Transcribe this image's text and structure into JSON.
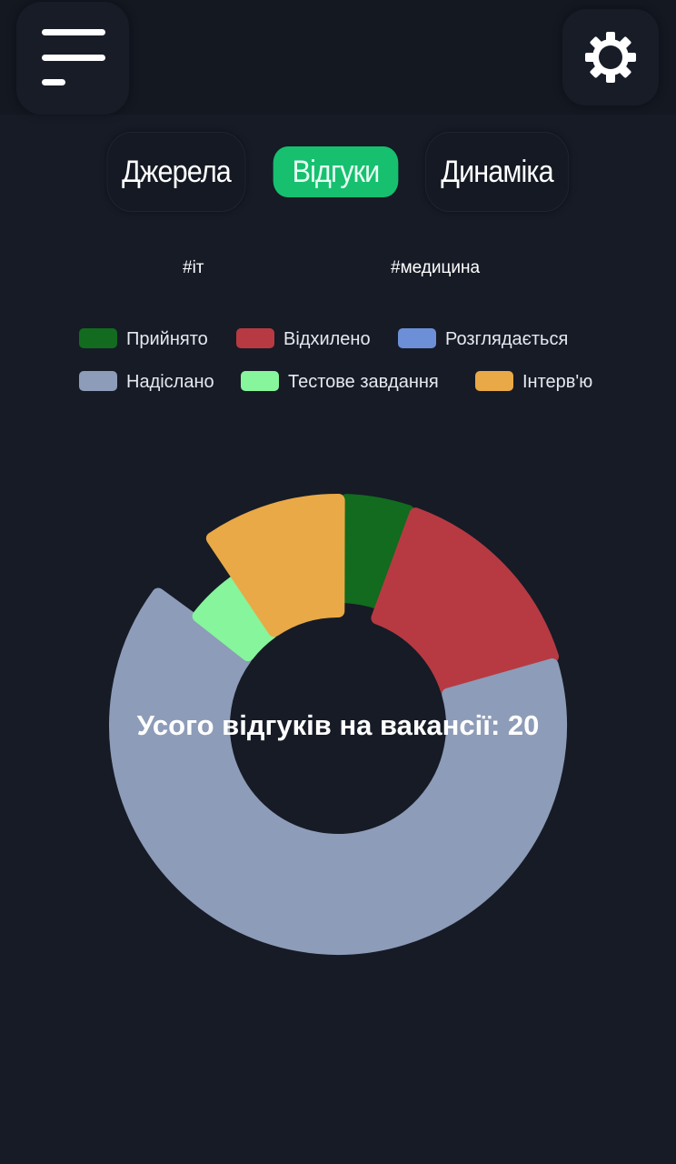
{
  "header": {
    "menu_icon": "hamburger-menu-icon",
    "settings_icon": "gear-icon"
  },
  "tabs": [
    {
      "label": "Джерела",
      "active": false
    },
    {
      "label": "Відгуки",
      "active": true
    },
    {
      "label": "Динаміка",
      "active": false
    }
  ],
  "tags": [
    "#іт",
    "#медицина"
  ],
  "colors": {
    "background": "#161b26",
    "active_tab": "#16c06f"
  },
  "chart_data": {
    "type": "pie",
    "center_label": "Усого відгуків на вакансії: 20",
    "total": 20,
    "legend": [
      {
        "label": "Прийнято",
        "color": "#126b1e"
      },
      {
        "label": "Відхилено",
        "color": "#b73a42"
      },
      {
        "label": "Розглядається",
        "color": "#6c8fd8"
      },
      {
        "label": "Надіслано",
        "color": "#8d9cb8"
      },
      {
        "label": "Тестове завдання",
        "color": "#86f59c"
      },
      {
        "label": "Інтерв'ю",
        "color": "#e9a946"
      }
    ],
    "slices": [
      {
        "label": "Прийнято",
        "value": 1,
        "color": "#126b1e"
      },
      {
        "label": "Відхилено",
        "value": 3,
        "color": "#b73a42"
      },
      {
        "label": "Розглядається",
        "value": 0,
        "color": "#6c8fd8"
      },
      {
        "label": "Надіслано",
        "value": 13,
        "color": "#8d9cb8"
      },
      {
        "label": "Тестове завдання",
        "value": 1,
        "color": "#86f59c"
      },
      {
        "label": "Інтерв'ю",
        "value": 2,
        "color": "#e9a946"
      }
    ]
  }
}
